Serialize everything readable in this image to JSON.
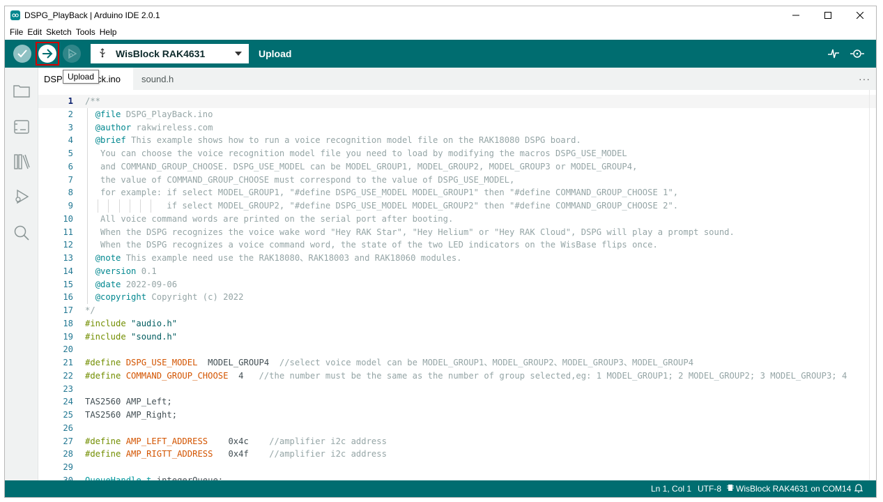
{
  "window": {
    "title": "DSPG_PlayBack | Arduino IDE 2.0.1",
    "minimize": "–",
    "maximize": "☐",
    "close": "✕"
  },
  "menu": [
    "File",
    "Edit",
    "Sketch",
    "Tools",
    "Help"
  ],
  "toolbar": {
    "board": "WisBlock RAK4631",
    "upload_label": "Upload",
    "icons": [
      "verify-icon",
      "upload-icon",
      "debug-icon",
      "serial-plotter-icon",
      "serial-monitor-icon"
    ]
  },
  "tooltip": "Upload",
  "tabs": {
    "active_visible": "DSP",
    "active_visible_tail": "ack.ino",
    "second": "sound.h",
    "more": "···"
  },
  "editor": {
    "lines": [
      {
        "n": "1",
        "segs": [
          [
            "c-comment",
            "/**"
          ]
        ]
      },
      {
        "n": "2",
        "guides": 1,
        "segs": [
          [
            "c-comment",
            "  "
          ],
          [
            "c-tag",
            "@file"
          ],
          [
            "c-comment",
            " DSPG_PlayBack.ino"
          ]
        ]
      },
      {
        "n": "3",
        "guides": 1,
        "segs": [
          [
            "c-comment",
            "  "
          ],
          [
            "c-tag",
            "@author"
          ],
          [
            "c-comment",
            " rakwireless.com"
          ]
        ]
      },
      {
        "n": "4",
        "guides": 1,
        "segs": [
          [
            "c-comment",
            "  "
          ],
          [
            "c-tag",
            "@brief"
          ],
          [
            "c-comment",
            " This example shows how to run a voice recognition model file on the RAK18080 DSPG board."
          ]
        ]
      },
      {
        "n": "5",
        "guides": 1,
        "segs": [
          [
            "c-comment",
            "   You can choose the voice recognition model file you need to load by modifying the macros DSPG_USE_MODEL"
          ]
        ]
      },
      {
        "n": "6",
        "guides": 1,
        "segs": [
          [
            "c-comment",
            "   and COMMAND_GROUP_CHOOSE. DSPG_USE_MODEL can be MODEL_GROUP1, MODEL_GROUP2, MODEL_GROUP3 or MODEL_GROUP4,"
          ]
        ]
      },
      {
        "n": "7",
        "guides": 1,
        "segs": [
          [
            "c-comment",
            "   the value of COMMAND_GROUP_CHOOSE must correspond to the value of DSPG_USE_MODEL,"
          ]
        ]
      },
      {
        "n": "8",
        "guides": 1,
        "segs": [
          [
            "c-comment",
            "   for example: if select MODEL_GROUP1, \"#define DSPG_USE_MODEL MODEL_GROUP1\" then \"#define COMMAND_GROUP_CHOOSE 1\","
          ]
        ]
      },
      {
        "n": "9",
        "guides": 7,
        "segs": [
          [
            "c-comment",
            "                if select MODEL_GROUP2, \"#define DSPG_USE_MODEL MODEL_GROUP2\" then \"#define COMMAND_GROUP_CHOOSE 2\"."
          ]
        ]
      },
      {
        "n": "10",
        "guides": 1,
        "segs": [
          [
            "c-comment",
            "   All voice command words are printed on the serial port after booting."
          ]
        ]
      },
      {
        "n": "11",
        "guides": 1,
        "segs": [
          [
            "c-comment",
            "   When the DSPG recognizes the voice wake word \"Hey RAK Star\", \"Hey Helium\" or \"Hey RAK Cloud\", DSPG will play a prompt sound."
          ]
        ]
      },
      {
        "n": "12",
        "guides": 1,
        "segs": [
          [
            "c-comment",
            "   When the DSPG recognizes a voice command word, the state of the two LED indicators on the WisBase flips once."
          ]
        ]
      },
      {
        "n": "13",
        "guides": 1,
        "segs": [
          [
            "c-comment",
            "  "
          ],
          [
            "c-tag",
            "@note"
          ],
          [
            "c-comment",
            " This example need use the RAK18080、RAK18003 and RAK18060 modules."
          ]
        ]
      },
      {
        "n": "14",
        "guides": 1,
        "segs": [
          [
            "c-comment",
            "  "
          ],
          [
            "c-tag",
            "@version"
          ],
          [
            "c-comment",
            " 0.1"
          ]
        ]
      },
      {
        "n": "15",
        "guides": 1,
        "segs": [
          [
            "c-comment",
            "  "
          ],
          [
            "c-tag",
            "@date"
          ],
          [
            "c-comment",
            " 2022-09-06"
          ]
        ]
      },
      {
        "n": "16",
        "guides": 1,
        "segs": [
          [
            "c-comment",
            "  "
          ],
          [
            "c-tag",
            "@copyright"
          ],
          [
            "c-comment",
            " Copyright (c) 2022"
          ]
        ]
      },
      {
        "n": "17",
        "segs": [
          [
            "c-comment",
            "*/"
          ]
        ]
      },
      {
        "n": "18",
        "segs": [
          [
            "c-pre",
            "#include"
          ],
          [
            "c-plain",
            " "
          ],
          [
            "c-str",
            "\"audio.h\""
          ]
        ]
      },
      {
        "n": "19",
        "segs": [
          [
            "c-pre",
            "#include"
          ],
          [
            "c-plain",
            " "
          ],
          [
            "c-str",
            "\"sound.h\""
          ]
        ]
      },
      {
        "n": "20",
        "segs": []
      },
      {
        "n": "21",
        "segs": [
          [
            "c-pre",
            "#define"
          ],
          [
            "c-plain",
            " "
          ],
          [
            "c-macro",
            "DSPG_USE_MODEL"
          ],
          [
            "c-plain",
            "  MODEL_GROUP4  "
          ],
          [
            "c-comment",
            "//select voice model can be MODEL_GROUP1、MODEL_GROUP2、MODEL_GROUP3、MODEL_GROUP4"
          ]
        ]
      },
      {
        "n": "22",
        "segs": [
          [
            "c-pre",
            "#define"
          ],
          [
            "c-plain",
            " "
          ],
          [
            "c-macro",
            "COMMAND_GROUP_CHOOSE"
          ],
          [
            "c-plain",
            "  4   "
          ],
          [
            "c-comment",
            "//the number must be the same as the number of group selected,eg: 1 MODEL_GROUP1; 2 MODEL_GROUP2; 3 MODEL_GROUP3; 4"
          ]
        ]
      },
      {
        "n": "23",
        "segs": []
      },
      {
        "n": "24",
        "segs": [
          [
            "c-plain",
            "TAS2560 AMP_Left;"
          ]
        ]
      },
      {
        "n": "25",
        "segs": [
          [
            "c-plain",
            "TAS2560 AMP_Right;"
          ]
        ]
      },
      {
        "n": "26",
        "segs": []
      },
      {
        "n": "27",
        "segs": [
          [
            "c-pre",
            "#define"
          ],
          [
            "c-plain",
            " "
          ],
          [
            "c-macro",
            "AMP_LEFT_ADDRESS"
          ],
          [
            "c-plain",
            "    0x4c    "
          ],
          [
            "c-comment",
            "//amplifier i2c address"
          ]
        ]
      },
      {
        "n": "28",
        "segs": [
          [
            "c-pre",
            "#define"
          ],
          [
            "c-plain",
            " "
          ],
          [
            "c-macro",
            "AMP_RIGTT_ADDRESS"
          ],
          [
            "c-plain",
            "   0x4f    "
          ],
          [
            "c-comment",
            "//amplifier i2c address"
          ]
        ]
      },
      {
        "n": "29",
        "segs": []
      },
      {
        "n": "30",
        "segs": [
          [
            "c-type",
            "QueueHandle_t"
          ],
          [
            "c-plain",
            " integerQueue;"
          ]
        ]
      }
    ]
  },
  "status": {
    "position": "Ln 1, Col 1",
    "encoding": "UTF-8",
    "board_port": "WisBlock RAK4631 on COM14"
  },
  "colors": {
    "accent": "#006d70",
    "upload_highlight": "#d40000"
  }
}
